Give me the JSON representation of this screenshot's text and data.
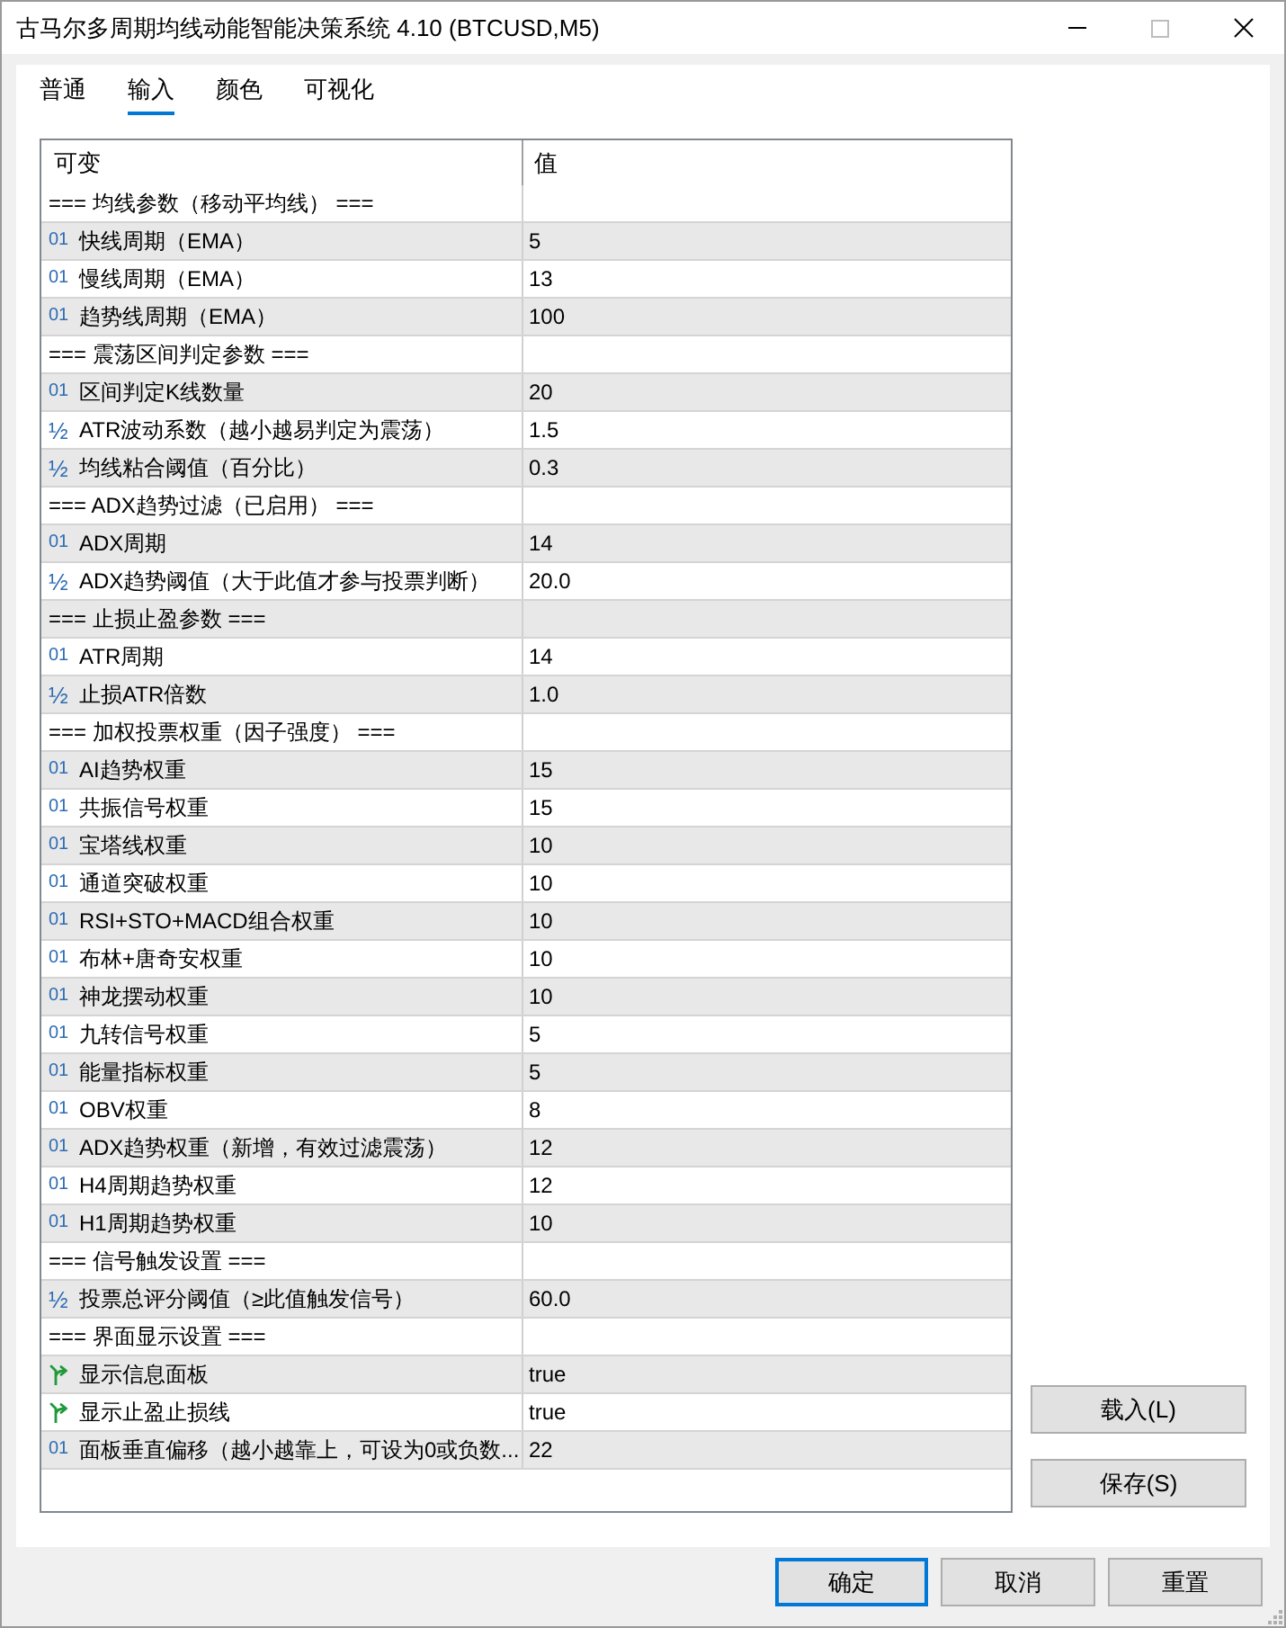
{
  "window": {
    "title": "古马尔多周期均线动能智能决策系统 4.10 (BTCUSD,M5)"
  },
  "tabs": [
    {
      "label": "普通",
      "selected": false
    },
    {
      "label": "输入",
      "selected": true
    },
    {
      "label": "颜色",
      "selected": false
    },
    {
      "label": "可视化",
      "selected": false
    }
  ],
  "table": {
    "columns": [
      "可变",
      "值"
    ],
    "rows": [
      {
        "kind": "group",
        "name": "=== 均线参数（移动平均线） ==="
      },
      {
        "kind": "int",
        "icon": "01",
        "name": "快线周期（EMA）",
        "value": "5"
      },
      {
        "kind": "int",
        "icon": "01",
        "name": "慢线周期（EMA）",
        "value": "13"
      },
      {
        "kind": "int",
        "icon": "01",
        "name": "趋势线周期（EMA）",
        "value": "100"
      },
      {
        "kind": "group",
        "name": "=== 震荡区间判定参数 ==="
      },
      {
        "kind": "int",
        "icon": "01",
        "name": "区间判定K线数量",
        "value": "20"
      },
      {
        "kind": "double",
        "icon": "½",
        "name": "ATR波动系数（越小越易判定为震荡）",
        "value": "1.5"
      },
      {
        "kind": "double",
        "icon": "½",
        "name": "均线粘合阈值（百分比）",
        "value": "0.3"
      },
      {
        "kind": "group",
        "name": "=== ADX趋势过滤（已启用） ==="
      },
      {
        "kind": "int",
        "icon": "01",
        "name": "ADX周期",
        "value": "14"
      },
      {
        "kind": "double",
        "icon": "½",
        "name": "ADX趋势阈值（大于此值才参与投票判断）",
        "value": "20.0"
      },
      {
        "kind": "group",
        "name": "=== 止损止盈参数 ==="
      },
      {
        "kind": "int",
        "icon": "01",
        "name": "ATR周期",
        "value": "14"
      },
      {
        "kind": "double",
        "icon": "½",
        "name": "止损ATR倍数",
        "value": "1.0"
      },
      {
        "kind": "group",
        "name": "=== 加权投票权重（因子强度） ==="
      },
      {
        "kind": "int",
        "icon": "01",
        "name": "AI趋势权重",
        "value": "15"
      },
      {
        "kind": "int",
        "icon": "01",
        "name": "共振信号权重",
        "value": "15"
      },
      {
        "kind": "int",
        "icon": "01",
        "name": "宝塔线权重",
        "value": "10"
      },
      {
        "kind": "int",
        "icon": "01",
        "name": "通道突破权重",
        "value": "10"
      },
      {
        "kind": "int",
        "icon": "01",
        "name": "RSI+STO+MACD组合权重",
        "value": "10"
      },
      {
        "kind": "int",
        "icon": "01",
        "name": "布林+唐奇安权重",
        "value": "10"
      },
      {
        "kind": "int",
        "icon": "01",
        "name": "神龙摆动权重",
        "value": "10"
      },
      {
        "kind": "int",
        "icon": "01",
        "name": "九转信号权重",
        "value": "5"
      },
      {
        "kind": "int",
        "icon": "01",
        "name": "能量指标权重",
        "value": "5"
      },
      {
        "kind": "int",
        "icon": "01",
        "name": "OBV权重",
        "value": "8"
      },
      {
        "kind": "int",
        "icon": "01",
        "name": "ADX趋势权重（新增，有效过滤震荡）",
        "value": "12"
      },
      {
        "kind": "int",
        "icon": "01",
        "name": "H4周期趋势权重",
        "value": "12"
      },
      {
        "kind": "int",
        "icon": "01",
        "name": "H1周期趋势权重",
        "value": "10"
      },
      {
        "kind": "group",
        "name": "=== 信号触发设置 ==="
      },
      {
        "kind": "double",
        "icon": "½",
        "name": "投票总评分阈值（≥此值触发信号）",
        "value": "60.0"
      },
      {
        "kind": "group",
        "name": "=== 界面显示设置 ==="
      },
      {
        "kind": "bool",
        "name": "显示信息面板",
        "value": "true"
      },
      {
        "kind": "bool",
        "name": "显示止盈止损线",
        "value": "true"
      },
      {
        "kind": "int",
        "icon": "01",
        "name": "面板垂直偏移（越小越靠上，可设为0或负数...",
        "value": "22"
      }
    ]
  },
  "side_buttons": [
    "载入(L)",
    "保存(S)"
  ],
  "dialog_buttons": [
    {
      "label": "确定",
      "default": true
    },
    {
      "label": "取消",
      "default": false
    },
    {
      "label": "重置",
      "default": false
    }
  ]
}
